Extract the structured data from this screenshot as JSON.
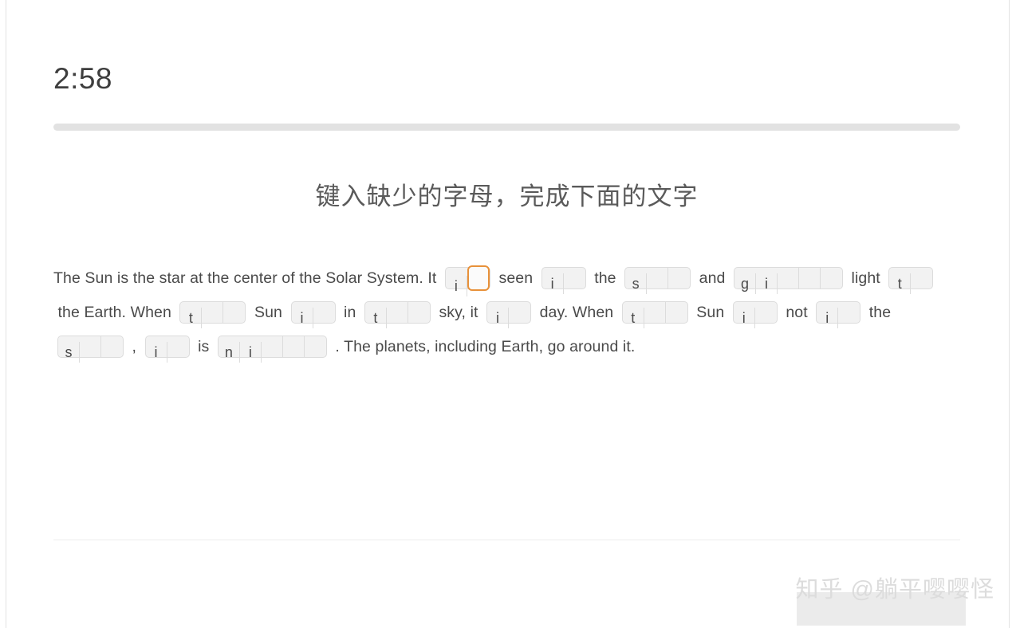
{
  "timer": {
    "value": "2:58"
  },
  "progress": {
    "percent": 0,
    "fill_color": "#f0a04b",
    "track_color": "#e2e2e2"
  },
  "heading": {
    "text": "键入缺少的字母，完成下面的文字"
  },
  "watermark": {
    "text": "知乎 @躺平嘤嘤怪"
  },
  "exercise": {
    "tokens": [
      {
        "type": "text",
        "text": "The Sun is the star at the center of the Solar System. It"
      },
      {
        "type": "group",
        "cells": [
          "i",
          ""
        ],
        "active_index": 1
      },
      {
        "type": "text",
        "text": "seen"
      },
      {
        "type": "group",
        "cells": [
          "i",
          ""
        ],
        "active_index": -1
      },
      {
        "type": "text",
        "text": "the"
      },
      {
        "type": "group",
        "cells": [
          "s",
          "",
          ""
        ],
        "active_index": -1
      },
      {
        "type": "text",
        "text": "and"
      },
      {
        "type": "group",
        "cells": [
          "g",
          "i",
          "",
          "",
          ""
        ],
        "active_index": -1
      },
      {
        "type": "text",
        "text": "light"
      },
      {
        "type": "group",
        "cells": [
          "t",
          ""
        ],
        "active_index": -1
      },
      {
        "type": "text",
        "text": "the Earth. When"
      },
      {
        "type": "group",
        "cells": [
          "t",
          "",
          ""
        ],
        "active_index": -1
      },
      {
        "type": "text",
        "text": "Sun"
      },
      {
        "type": "group",
        "cells": [
          "i",
          ""
        ],
        "active_index": -1
      },
      {
        "type": "text",
        "text": "in"
      },
      {
        "type": "group",
        "cells": [
          "t",
          "",
          ""
        ],
        "active_index": -1
      },
      {
        "type": "text",
        "text": "sky, it"
      },
      {
        "type": "group",
        "cells": [
          "i",
          ""
        ],
        "active_index": -1
      },
      {
        "type": "text",
        "text": "day. When"
      },
      {
        "type": "group",
        "cells": [
          "t",
          "",
          ""
        ],
        "active_index": -1
      },
      {
        "type": "text",
        "text": "Sun"
      },
      {
        "type": "group",
        "cells": [
          "i",
          ""
        ],
        "active_index": -1
      },
      {
        "type": "text",
        "text": "not"
      },
      {
        "type": "group",
        "cells": [
          "i",
          ""
        ],
        "active_index": -1
      },
      {
        "type": "text",
        "text": "the"
      },
      {
        "type": "group",
        "cells": [
          "s",
          "",
          ""
        ],
        "active_index": -1
      },
      {
        "type": "text",
        "text": ","
      },
      {
        "type": "group",
        "cells": [
          "i",
          ""
        ],
        "active_index": -1
      },
      {
        "type": "text",
        "text": "is"
      },
      {
        "type": "group",
        "cells": [
          "n",
          "i",
          "",
          "",
          ""
        ],
        "active_index": -1
      },
      {
        "type": "text",
        "text": ". The planets, including Earth, go around it."
      }
    ]
  },
  "colors": {
    "active_cell_border": "#e8913a",
    "cell_background": "#f2f2f2",
    "cell_border": "#dcdcdc",
    "text": "#4a4a4a",
    "heading_text": "#5a5a5a"
  }
}
